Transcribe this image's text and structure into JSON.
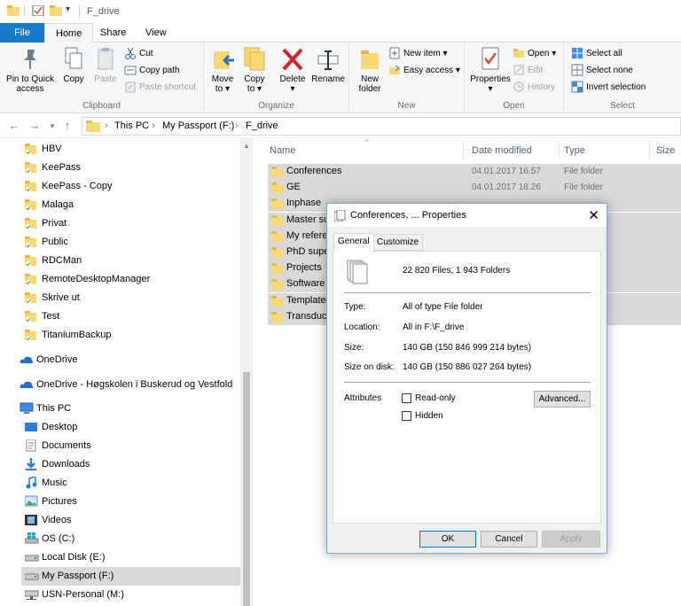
{
  "window": {
    "title": "F_drive"
  },
  "tabs": [
    {
      "label": "File"
    },
    {
      "label": "Home"
    },
    {
      "label": "Share"
    },
    {
      "label": "View"
    }
  ],
  "ribbon": {
    "clipboard": {
      "label": "Clipboard",
      "pin": "Pin to Quick access",
      "pin_line1": "Pin to Quick",
      "pin_line2": "access",
      "copy": "Copy",
      "paste": "Paste",
      "cut": "Cut",
      "copy_path": "Copy path",
      "paste_shortcut": "Paste shortcut"
    },
    "organize": {
      "label": "Organize",
      "move_to": "Move",
      "move_to2": "to ▾",
      "copy_to": "Copy",
      "copy_to2": "to ▾",
      "delete": "Delete",
      "delete2": "▾",
      "rename": "Rename"
    },
    "new": {
      "label": "New",
      "new_folder": "New",
      "new_folder2": "folder",
      "new_item": "New item ▾",
      "easy_access": "Easy access ▾"
    },
    "open": {
      "label": "Open",
      "properties": "Properties",
      "properties2": "▾",
      "open": "Open ▾",
      "edit": "Edit",
      "history": "History"
    },
    "select": {
      "label": "Select",
      "select_all": "Select all",
      "select_none": "Select none",
      "invert": "Invert selection"
    }
  },
  "address": {
    "crumbs": [
      "This PC",
      "My Passport (F:)",
      "F_drive"
    ]
  },
  "nav": {
    "folders": [
      "HBV",
      "KeePass",
      "KeePass - Copy",
      "Malaga",
      "Privat",
      "Public",
      "RDCMan",
      "RemoteDesktopManager",
      "Skrive ut",
      "Test",
      "TitaniumBackup"
    ],
    "onedrive": "OneDrive",
    "onedrive_org": "OneDrive - Høgskolen i Buskerud og Vestfold",
    "this_pc": "This PC",
    "pc_items": [
      "Desktop",
      "Documents",
      "Downloads",
      "Music",
      "Pictures",
      "Videos",
      "OS (C:)",
      "Local Disk (E:)",
      "My Passport (F:)",
      "USN-Personal (M:)"
    ]
  },
  "columns": {
    "name": "Name",
    "date": "Date modified",
    "type": "Type",
    "size": "Size"
  },
  "files": [
    {
      "name": "Conferences",
      "date": "04.01.2017 16.57",
      "type": "File folder"
    },
    {
      "name": "GE",
      "date": "04.01.2017 18.26",
      "type": "File folder"
    },
    {
      "name": "Inphase",
      "date": "",
      "type": ""
    },
    {
      "name": "Master su",
      "date": "",
      "type": ""
    },
    {
      "name": "My referer",
      "date": "",
      "type": ""
    },
    {
      "name": "PhD super",
      "date": "",
      "type": ""
    },
    {
      "name": "Projects",
      "date": "",
      "type": ""
    },
    {
      "name": "Software",
      "date": "",
      "type": ""
    },
    {
      "name": "Templates",
      "date": "",
      "type": ""
    },
    {
      "name": "Transduce",
      "date": "",
      "type": ""
    }
  ],
  "dialog": {
    "title": "Conferences, ... Properties",
    "tab_general": "General",
    "tab_customize": "Customize",
    "summary": "22 820 Files, 1 943 Folders",
    "type_label": "Type:",
    "type_value": "All of type File folder",
    "location_label": "Location:",
    "location_value": "All in F:\\F_drive",
    "size_label": "Size:",
    "size_value": "140 GB (150 846 999 214 bytes)",
    "size_disk_label": "Size on disk:",
    "size_disk_value": "140 GB (150 886 027 264 bytes)",
    "attributes_label": "Attributes",
    "readonly": "Read-only",
    "hidden": "Hidden",
    "advanced": "Advanced...",
    "ok": "OK",
    "cancel": "Cancel",
    "apply": "Apply"
  }
}
